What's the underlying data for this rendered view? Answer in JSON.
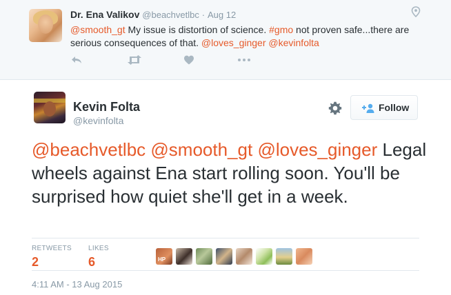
{
  "parent_tweet": {
    "name": "Dr. Ena Valikov",
    "handle": "@beachvetlbc",
    "separator": "·",
    "date": "Aug 12",
    "text_segments": [
      {
        "text": "@smooth_gt",
        "link": true
      },
      {
        "text": " My issue is distortion of science.  ",
        "link": false
      },
      {
        "text": "#gmo",
        "link": true
      },
      {
        "text": " not proven safe...there are serious consequences of that.  ",
        "link": false
      },
      {
        "text": "@loves_ginger",
        "link": true
      },
      {
        "text": " ",
        "link": false
      },
      {
        "text": "@kevinfolta",
        "link": true
      }
    ],
    "actions": [
      "reply-icon",
      "retweet-icon",
      "like-icon",
      "more-icon"
    ]
  },
  "main_tweet": {
    "name": "Kevin Folta",
    "handle": "@kevinfolta",
    "follow_label": "Follow",
    "settings_icon": "gear-icon",
    "text_segments": [
      {
        "text": "@beachvetlbc",
        "link": true
      },
      {
        "text": " ",
        "link": false
      },
      {
        "text": "@smooth_gt",
        "link": true
      },
      {
        "text": " ",
        "link": false
      },
      {
        "text": "@loves_ginger",
        "link": true
      },
      {
        "text": " Legal wheels against Ena start rolling soon. You'll be surprised how quiet she'll get in a week.",
        "link": false
      }
    ],
    "stats": {
      "retweets_label": "RETWEETS",
      "retweets": "2",
      "likes_label": "LIKES",
      "likes": "6"
    },
    "timestamp": "4:11 AM - 13 Aug 2015"
  },
  "likers": [
    {
      "name": "liker-1",
      "initials": "HP"
    },
    {
      "name": "liker-2",
      "initials": ""
    },
    {
      "name": "liker-3",
      "initials": ""
    },
    {
      "name": "liker-4",
      "initials": ""
    },
    {
      "name": "liker-5",
      "initials": ""
    },
    {
      "name": "liker-6",
      "initials": ""
    },
    {
      "name": "liker-7",
      "initials": ""
    },
    {
      "name": "liker-8",
      "initials": ""
    }
  ],
  "colors": {
    "link": "#e65a2a",
    "muted": "#8899a6",
    "text": "#292f33",
    "border": "#e1e8ed",
    "parent_bg": "#f5f8fa"
  }
}
